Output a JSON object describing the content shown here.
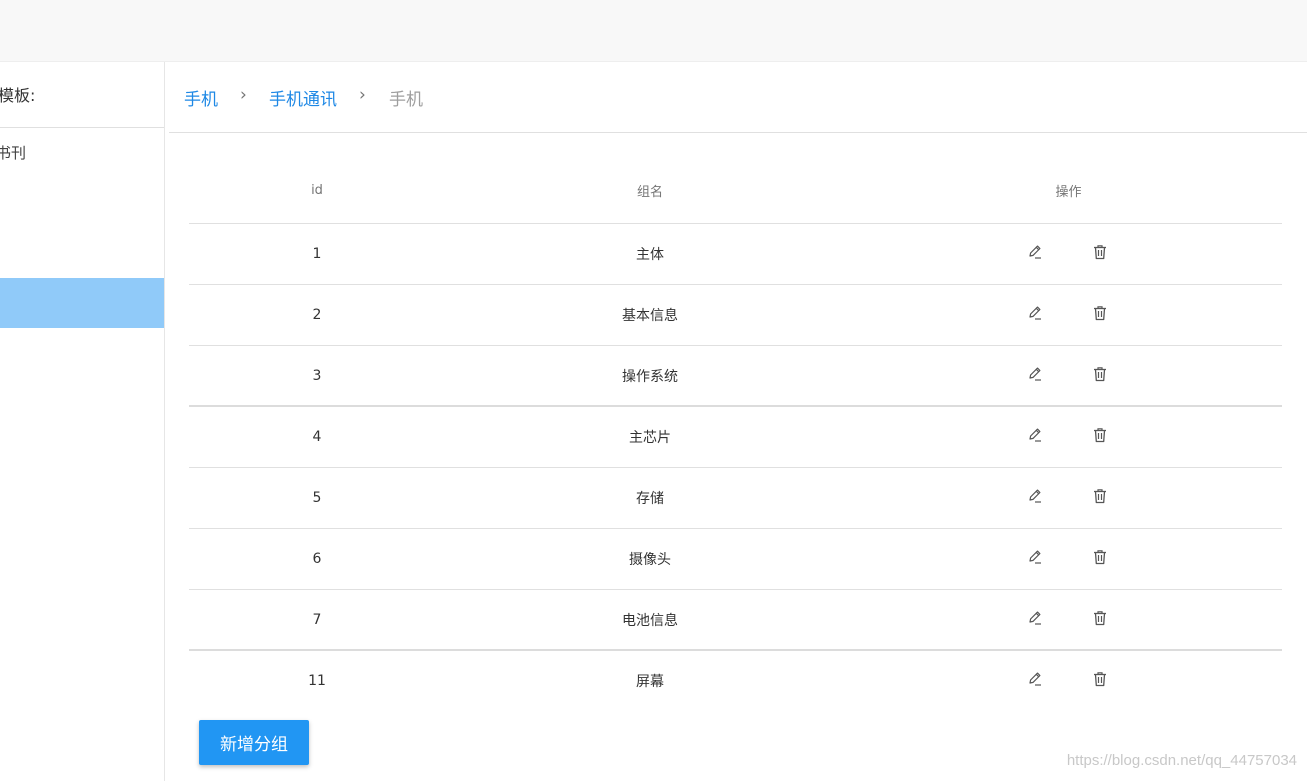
{
  "sidebar": {
    "header": "模板:",
    "item": "书刊"
  },
  "breadcrumb": {
    "items": [
      "手机",
      "手机通讯",
      "手机"
    ],
    "separator": "›"
  },
  "table": {
    "headers": {
      "id": "id",
      "name": "组名",
      "actions": "操作"
    },
    "rows": [
      {
        "id": "1",
        "name": "主体"
      },
      {
        "id": "2",
        "name": "基本信息"
      },
      {
        "id": "3",
        "name": "操作系统"
      },
      {
        "id": "4",
        "name": "主芯片"
      },
      {
        "id": "5",
        "name": "存储"
      },
      {
        "id": "6",
        "name": "摄像头"
      },
      {
        "id": "7",
        "name": "电池信息"
      },
      {
        "id": "11",
        "name": "屏幕"
      }
    ],
    "row_icons": [
      "pencil-icon",
      "trash-icon"
    ]
  },
  "add_button": "新增分组",
  "watermark": "https://blog.csdn.net/qq_44757034",
  "colors": {
    "primary": "#2196f3",
    "link": "#1e88e5",
    "selected": "#90caf9"
  }
}
